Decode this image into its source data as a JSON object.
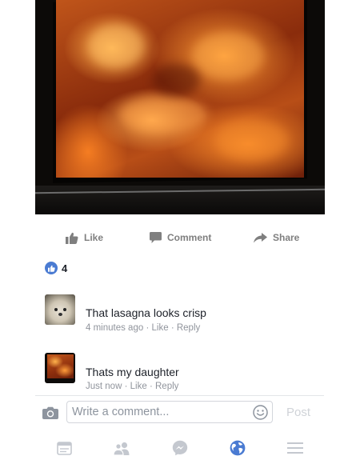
{
  "actions": {
    "like_label": "Like",
    "comment_label": "Comment",
    "share_label": "Share"
  },
  "reactions": {
    "count": "4"
  },
  "comments": [
    {
      "text": "That lasagna looks crisp",
      "time": "4 minutes ago",
      "like_label": "Like",
      "reply_label": "Reply",
      "separator": "·"
    },
    {
      "text": "Thats my daughter",
      "time": "Just now",
      "like_label": "Like",
      "reply_label": "Reply",
      "separator": "·"
    }
  ],
  "composer": {
    "placeholder": "Write a comment...",
    "post_label": "Post"
  },
  "tabbar": {
    "items": [
      "news-feed-icon",
      "friends-icon",
      "messenger-icon",
      "notifications-globe-icon",
      "menu-icon"
    ],
    "active_item": "notifications-globe-icon"
  },
  "colors": {
    "accent": "#4a7bd2",
    "muted_text": "#90949c",
    "action_gray": "#7f7f7f",
    "tab_inactive": "#c4c8cf"
  }
}
